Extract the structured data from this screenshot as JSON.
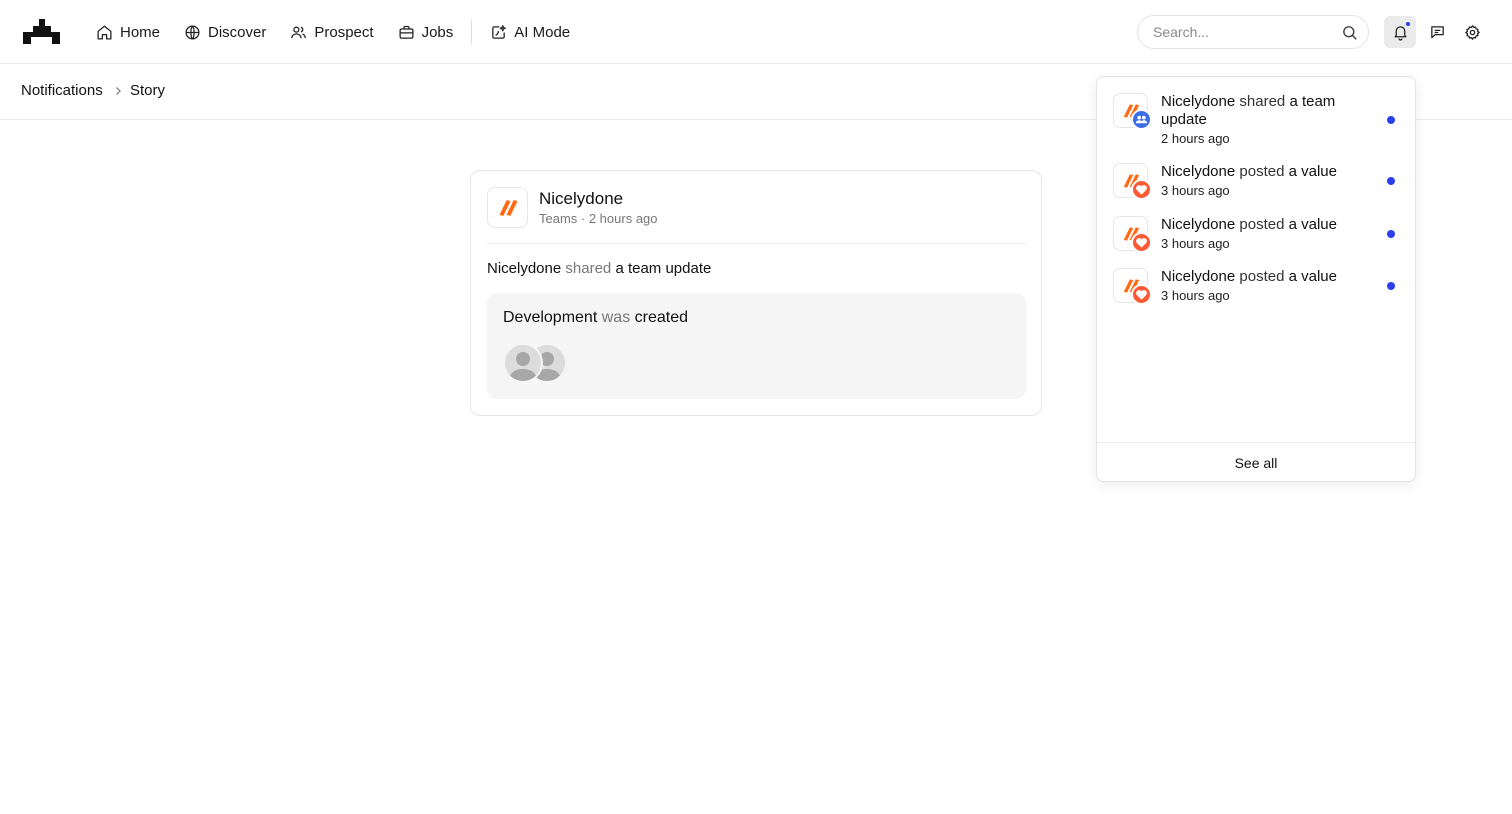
{
  "nav": {
    "items": [
      {
        "label": "Home",
        "icon": "home-icon"
      },
      {
        "label": "Discover",
        "icon": "globe-icon"
      },
      {
        "label": "Prospect",
        "icon": "users-icon"
      },
      {
        "label": "Jobs",
        "icon": "briefcase-icon"
      },
      {
        "label": "AI Mode",
        "icon": "ai-sparkle-icon"
      }
    ]
  },
  "search": {
    "placeholder": "Search..."
  },
  "breadcrumb": {
    "items": [
      "Notifications",
      "Story"
    ]
  },
  "story": {
    "author": "Nicelydone",
    "meta": "Teams · 2 hours ago",
    "text": {
      "actor": "Nicelydone",
      "verb": "shared",
      "object": "a team update"
    },
    "content": {
      "subject": "Development",
      "verb": "was",
      "action": "created"
    }
  },
  "notifications": {
    "items": [
      {
        "actor": "Nicelydone",
        "verb": "shared",
        "object": "a team update",
        "time": "2 hours ago",
        "badge": "team-icon",
        "unread": true
      },
      {
        "actor": "Nicelydone",
        "verb": "posted",
        "object": "a value",
        "time": "3 hours ago",
        "badge": "heart-icon",
        "unread": true
      },
      {
        "actor": "Nicelydone",
        "verb": "posted",
        "object": "a value",
        "time": "3 hours ago",
        "badge": "heart-icon",
        "unread": true
      },
      {
        "actor": "Nicelydone",
        "verb": "posted",
        "object": "a value",
        "time": "3 hours ago",
        "badge": "heart-icon",
        "unread": true
      }
    ],
    "see_all": "See all"
  },
  "colors": {
    "brand_orange": "#ff6a13",
    "unread_blue": "#2b3ff0",
    "team_badge": "#3b6de6",
    "heart_badge": "#ff5a36"
  }
}
